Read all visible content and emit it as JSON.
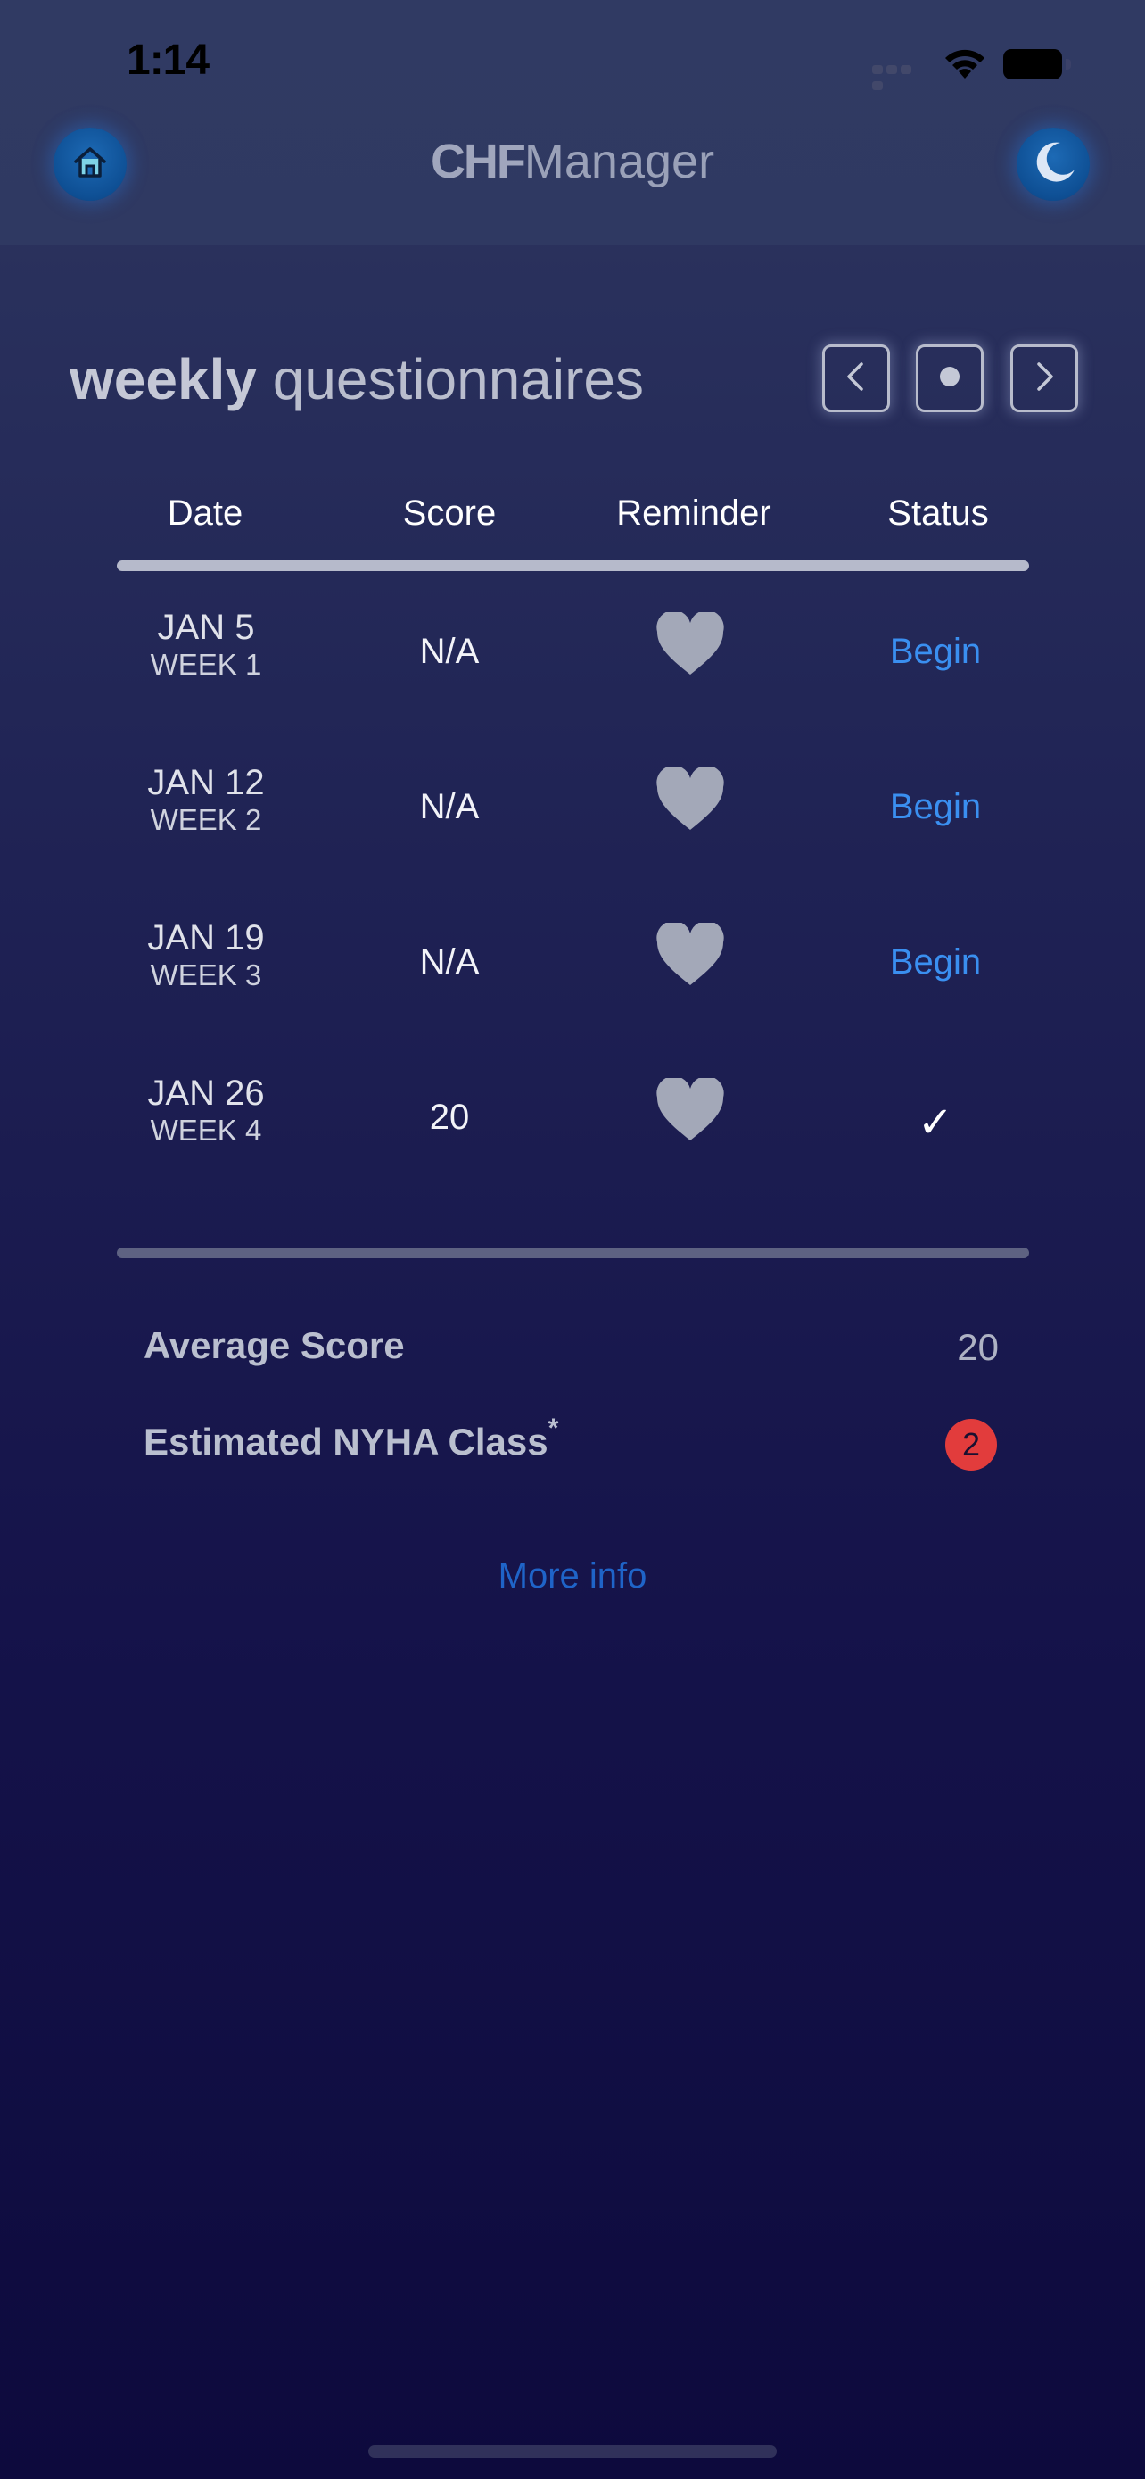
{
  "status_bar": {
    "time": "1:14"
  },
  "header": {
    "title_bold": "CHF",
    "title_regular": "Manager",
    "home_icon": "home-icon",
    "moon_icon": "moon-icon"
  },
  "section": {
    "title_bold": "weekly",
    "title_regular": " questionnaires"
  },
  "table": {
    "columns": [
      "Date",
      "Score",
      "Reminder",
      "Status"
    ],
    "rows": [
      {
        "date": "JAN 5",
        "week": "WEEK 1",
        "score": "N/A",
        "status": "Begin"
      },
      {
        "date": "JAN 12",
        "week": "WEEK 2",
        "score": "N/A",
        "status": "Begin"
      },
      {
        "date": "JAN 19",
        "week": "WEEK 3",
        "score": "N/A",
        "status": "Begin"
      },
      {
        "date": "JAN 26",
        "week": "WEEK 4",
        "score": "20",
        "status": "✓"
      }
    ]
  },
  "summary": {
    "average_label": "Average Score",
    "average_value": "20",
    "nyha_label": "Estimated NYHA Class",
    "nyha_marker": "*",
    "nyha_value": "2",
    "more_info": "More info"
  },
  "colors": {
    "accent_link": "#3a8ff0",
    "badge_red": "#e23c3c",
    "heart_gray": "#a3a8b8"
  }
}
